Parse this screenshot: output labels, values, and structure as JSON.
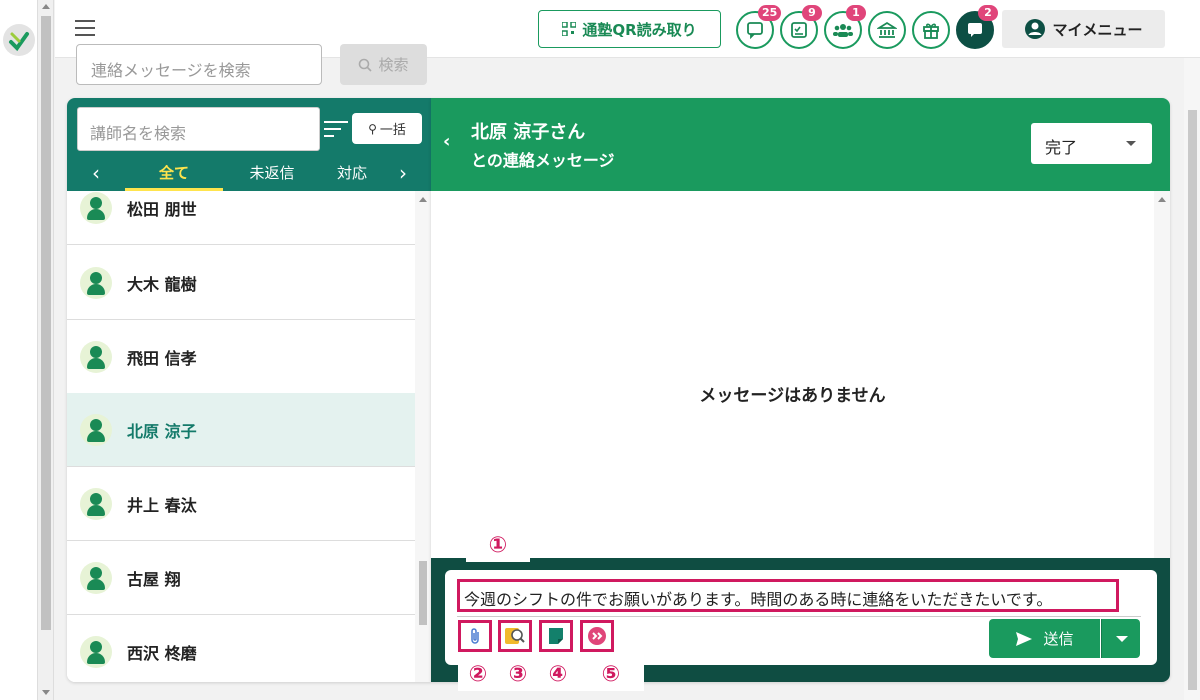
{
  "header": {
    "qr_button_label": "通塾QR読み取り",
    "icons": [
      {
        "name": "message-icon",
        "badge": "25"
      },
      {
        "name": "checklist-icon",
        "badge": "9"
      },
      {
        "name": "group-icon",
        "badge": "1"
      },
      {
        "name": "school-icon",
        "badge": ""
      },
      {
        "name": "gift-icon",
        "badge": ""
      },
      {
        "name": "chat-icon",
        "badge": "2"
      }
    ],
    "my_menu_label": "マイメニュー"
  },
  "message_search": {
    "placeholder": "連絡メッセージを検索",
    "button_label": "検索"
  },
  "list_panel": {
    "search_placeholder": "講師名を検索",
    "bulk_button_label": "一括",
    "tabs": [
      {
        "label": "全て",
        "active": true
      },
      {
        "label": "未返信",
        "active": false
      },
      {
        "label": "対応",
        "active": false
      }
    ],
    "teachers": [
      {
        "name": "松田 朋世",
        "selected": false
      },
      {
        "name": "大木 龍樹",
        "selected": false
      },
      {
        "name": "飛田 信孝",
        "selected": false
      },
      {
        "name": "北原 涼子",
        "selected": true
      },
      {
        "name": "井上 春汰",
        "selected": false
      },
      {
        "name": "古屋 翔",
        "selected": false
      },
      {
        "name": "西沢 柊磨",
        "selected": false
      }
    ]
  },
  "chat": {
    "title_line1": "北原 涼子さん",
    "title_line2": "との連絡メッセージ",
    "status_value": "完了",
    "empty_text": "メッセージはありません",
    "input_value": "今週のシフトの件でお願いがあります。時間のある時に連絡をいただきたいです。",
    "send_label": "送信"
  },
  "callouts": {
    "c1": "①",
    "c2": "②",
    "c3": "③",
    "c4": "④",
    "c5": "⑤"
  },
  "colors": {
    "brand_green": "#1a9a5e",
    "dark_teal": "#147a6a",
    "annotation_red": "#d0195f",
    "badge_pink": "#e0457a",
    "active_tab": "#ffe44d"
  }
}
